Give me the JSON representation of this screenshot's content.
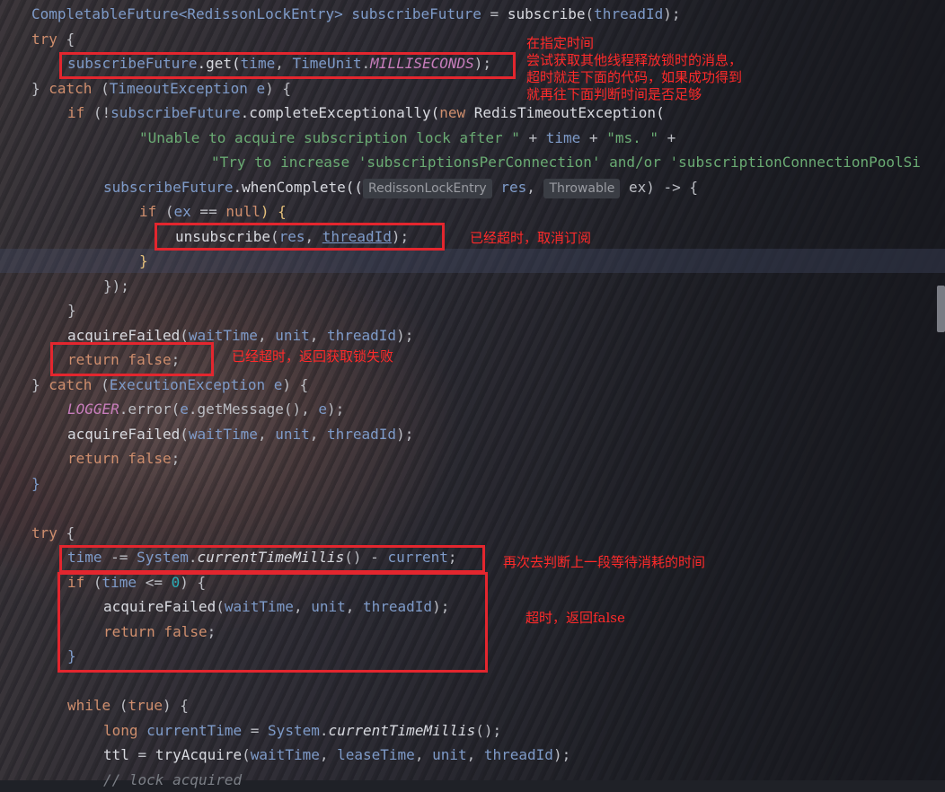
{
  "code_lines": [
    [
      "CompletableFuture<RedissonLockEntry> ",
      "subscribeFuture",
      " = ",
      "subscribe",
      "(",
      "threadId",
      ");"
    ],
    [
      "try",
      " {"
    ],
    [
      "subscribeFuture",
      ".get(",
      "time",
      ", ",
      "TimeUnit",
      ".",
      "MILLISECONDS",
      ");"
    ],
    [
      "} ",
      "catch",
      " (",
      "TimeoutException",
      " ",
      "e",
      ") {"
    ],
    [
      "if",
      " (!",
      "subscribeFuture",
      ".completeExceptionally(",
      "new",
      " RedisTimeoutException("
    ],
    [
      "\"Unable to acquire subscription lock after \"",
      " + ",
      "time",
      " + ",
      "\"ms. \"",
      " +"
    ],
    [
      "\"Try to increase 'subscriptionsPerConnection' and/or 'subscriptionConnectionPoolSi"
    ],
    [
      "subscribeFuture",
      ".whenComplete((",
      "RedissonLockEntry",
      " res",
      ", ",
      "Throwable",
      " ex) -> {"
    ],
    [
      "if",
      " (",
      "ex",
      " == ",
      "null",
      ") {"
    ],
    [
      "unsubscribe",
      "(",
      "res",
      ", ",
      "threadId",
      ");"
    ],
    [
      "}"
    ],
    [
      "});"
    ],
    [
      "}"
    ],
    [
      "acquireFailed",
      "(",
      "waitTime",
      ", ",
      "unit",
      ", ",
      "threadId",
      ");"
    ],
    [
      "return false",
      ";"
    ],
    [
      "} ",
      "catch",
      " (",
      "ExecutionException",
      " ",
      "e",
      ") {"
    ],
    [
      "LOGGER",
      ".error(",
      "e",
      ".getMessage(), ",
      "e",
      ");"
    ],
    [
      "acquireFailed",
      "(",
      "waitTime",
      ", ",
      "unit",
      ", ",
      "threadId",
      ");"
    ],
    [
      "return false",
      ";"
    ],
    [
      "}"
    ],
    [
      ""
    ],
    [
      "try",
      " {"
    ],
    [
      "time",
      " -= ",
      "System",
      ".",
      "currentTimeMillis",
      "() - ",
      "current",
      ";"
    ],
    [
      "if",
      " (",
      "time",
      " <= ",
      "0",
      ") {"
    ],
    [
      "acquireFailed",
      "(",
      "waitTime",
      ", ",
      "unit",
      ", ",
      "threadId",
      ");"
    ],
    [
      "return false",
      ";"
    ],
    [
      "}"
    ],
    [
      ""
    ],
    [
      "while",
      " (",
      "true",
      ") {"
    ],
    [
      "long",
      " ",
      "currentTime",
      " = ",
      "System",
      ".",
      "currentTimeMillis",
      "();"
    ],
    [
      "ttl",
      " = ",
      "tryAcquire",
      "(",
      "waitTime",
      ", ",
      "leaseTime",
      ", ",
      "unit",
      ", ",
      "threadId",
      ");"
    ],
    [
      "// lock acquired"
    ]
  ],
  "annotations": {
    "note1": [
      "在指定时间",
      "尝试获取其他线程释放锁时的消息，",
      "超时就走下面的代码，如果成功得到",
      "就再往下面判断时间是否足够"
    ],
    "note2": "已经超时，取消订阅",
    "note3": "已经超时，返回获取锁失败",
    "note4": "再次去判断上一段等待消耗的时间",
    "note5": "超时，返回false"
  },
  "colors": {
    "keyword": "#cf8e6d",
    "parameter": "#7e9bc9",
    "string": "#6aab73",
    "constant": "#c77dbb",
    "annotation_red": "#e3262e"
  }
}
